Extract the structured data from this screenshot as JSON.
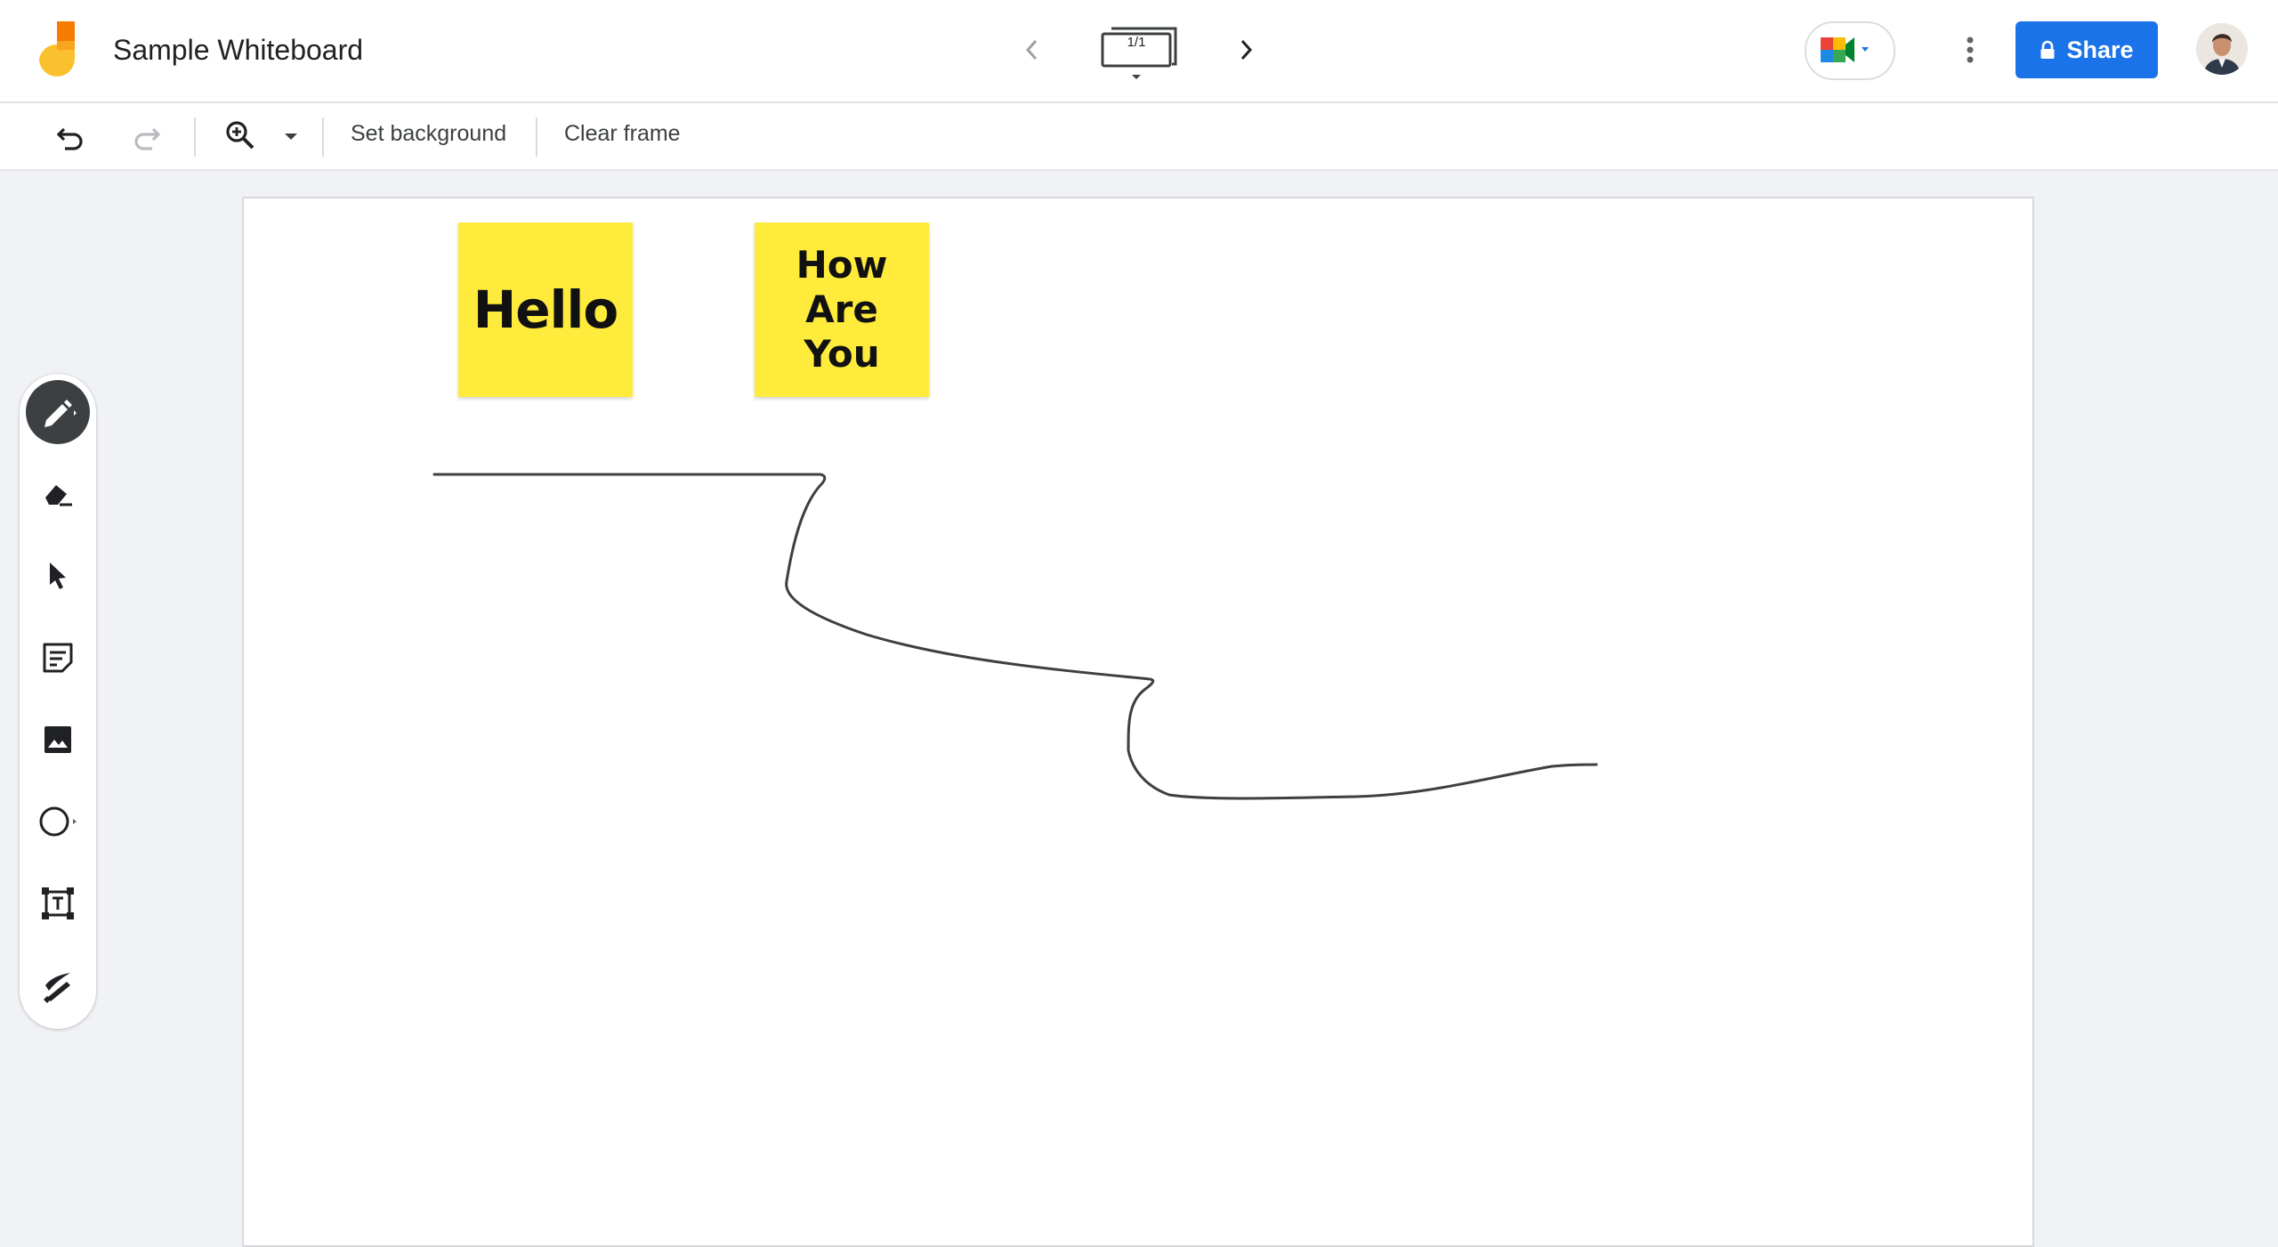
{
  "header": {
    "title": "Sample Whiteboard",
    "frame_indicator": "1/1",
    "share_label": "Share"
  },
  "toolbar": {
    "set_background_label": "Set background",
    "clear_frame_label": "Clear frame"
  },
  "tools": [
    {
      "name": "pen",
      "icon": "pen-icon",
      "active": true
    },
    {
      "name": "eraser",
      "icon": "eraser-icon"
    },
    {
      "name": "select",
      "icon": "select-arrow-icon"
    },
    {
      "name": "sticky-note",
      "icon": "sticky-note-icon"
    },
    {
      "name": "image",
      "icon": "image-icon"
    },
    {
      "name": "circle",
      "icon": "circle-icon"
    },
    {
      "name": "text-box",
      "icon": "text-box-icon"
    },
    {
      "name": "laser",
      "icon": "laser-icon"
    }
  ],
  "canvas": {
    "sticky_notes": [
      {
        "text": "Hello",
        "color": "#ffeb3b"
      },
      {
        "text": "How\nAre\nYou",
        "color": "#ffeb3b"
      }
    ]
  },
  "colors": {
    "accent": "#1a73e8",
    "sticky": "#ffeb3b",
    "logo_orange": "#f57c00",
    "logo_yellow": "#fbc02d"
  }
}
